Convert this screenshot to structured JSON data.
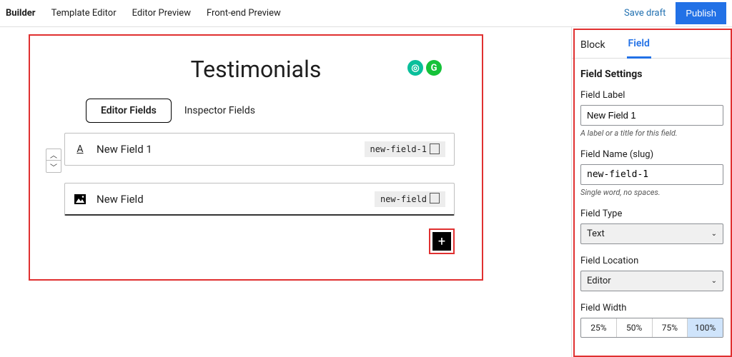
{
  "topnav": {
    "items": [
      "Builder",
      "Template Editor",
      "Editor Preview",
      "Front-end Preview"
    ],
    "active_index": 0,
    "save_draft": "Save draft",
    "publish": "Publish"
  },
  "canvas": {
    "title": "Testimonials",
    "tabs": {
      "editor": "Editor Fields",
      "inspector": "Inspector Fields"
    },
    "fields": [
      {
        "icon": "text",
        "label": "New Field 1",
        "slug": "new-field-1"
      },
      {
        "icon": "image",
        "label": "New Field",
        "slug": "new-field"
      }
    ]
  },
  "sidebar": {
    "tabs": {
      "block": "Block",
      "field": "Field",
      "active": "field"
    },
    "title": "Field Settings",
    "field_label": {
      "label": "Field Label",
      "value": "New Field 1",
      "help": "A label or a title for this field."
    },
    "field_name": {
      "label": "Field Name (slug)",
      "value": "new-field-1",
      "help": "Single word, no spaces."
    },
    "field_type": {
      "label": "Field Type",
      "value": "Text"
    },
    "field_location": {
      "label": "Field Location",
      "value": "Editor"
    },
    "field_width": {
      "label": "Field Width",
      "options": [
        "25%",
        "50%",
        "75%",
        "100%"
      ],
      "active_index": 3
    }
  }
}
